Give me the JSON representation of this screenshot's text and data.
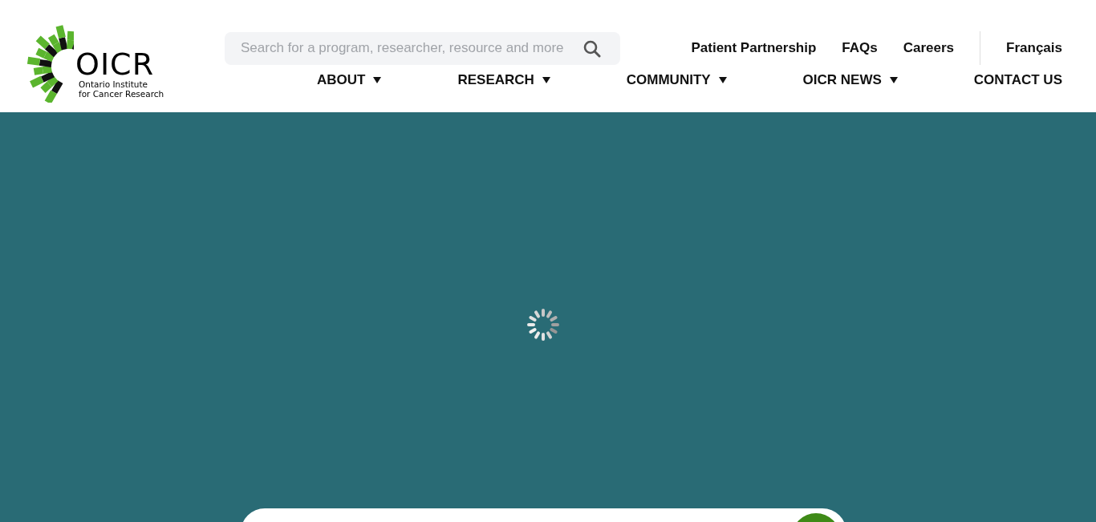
{
  "logo": {
    "acronym": "OICR",
    "line_1": "Ontario Institute",
    "line_2": "for Cancer Research"
  },
  "search": {
    "placeholder": "Search for a program, researcher, resource and more"
  },
  "utility_links": [
    {
      "label": "Patient Partnership"
    },
    {
      "label": "FAQs"
    },
    {
      "label": "Careers"
    }
  ],
  "language_link": {
    "label": "Français"
  },
  "nav": [
    {
      "label": "ABOUT",
      "has_dropdown": true
    },
    {
      "label": "RESEARCH",
      "has_dropdown": true
    },
    {
      "label": "COMMUNITY",
      "has_dropdown": true
    },
    {
      "label": "OICR NEWS",
      "has_dropdown": true
    },
    {
      "label": "CONTACT US",
      "has_dropdown": false
    }
  ],
  "hero": {
    "loading": true
  }
}
